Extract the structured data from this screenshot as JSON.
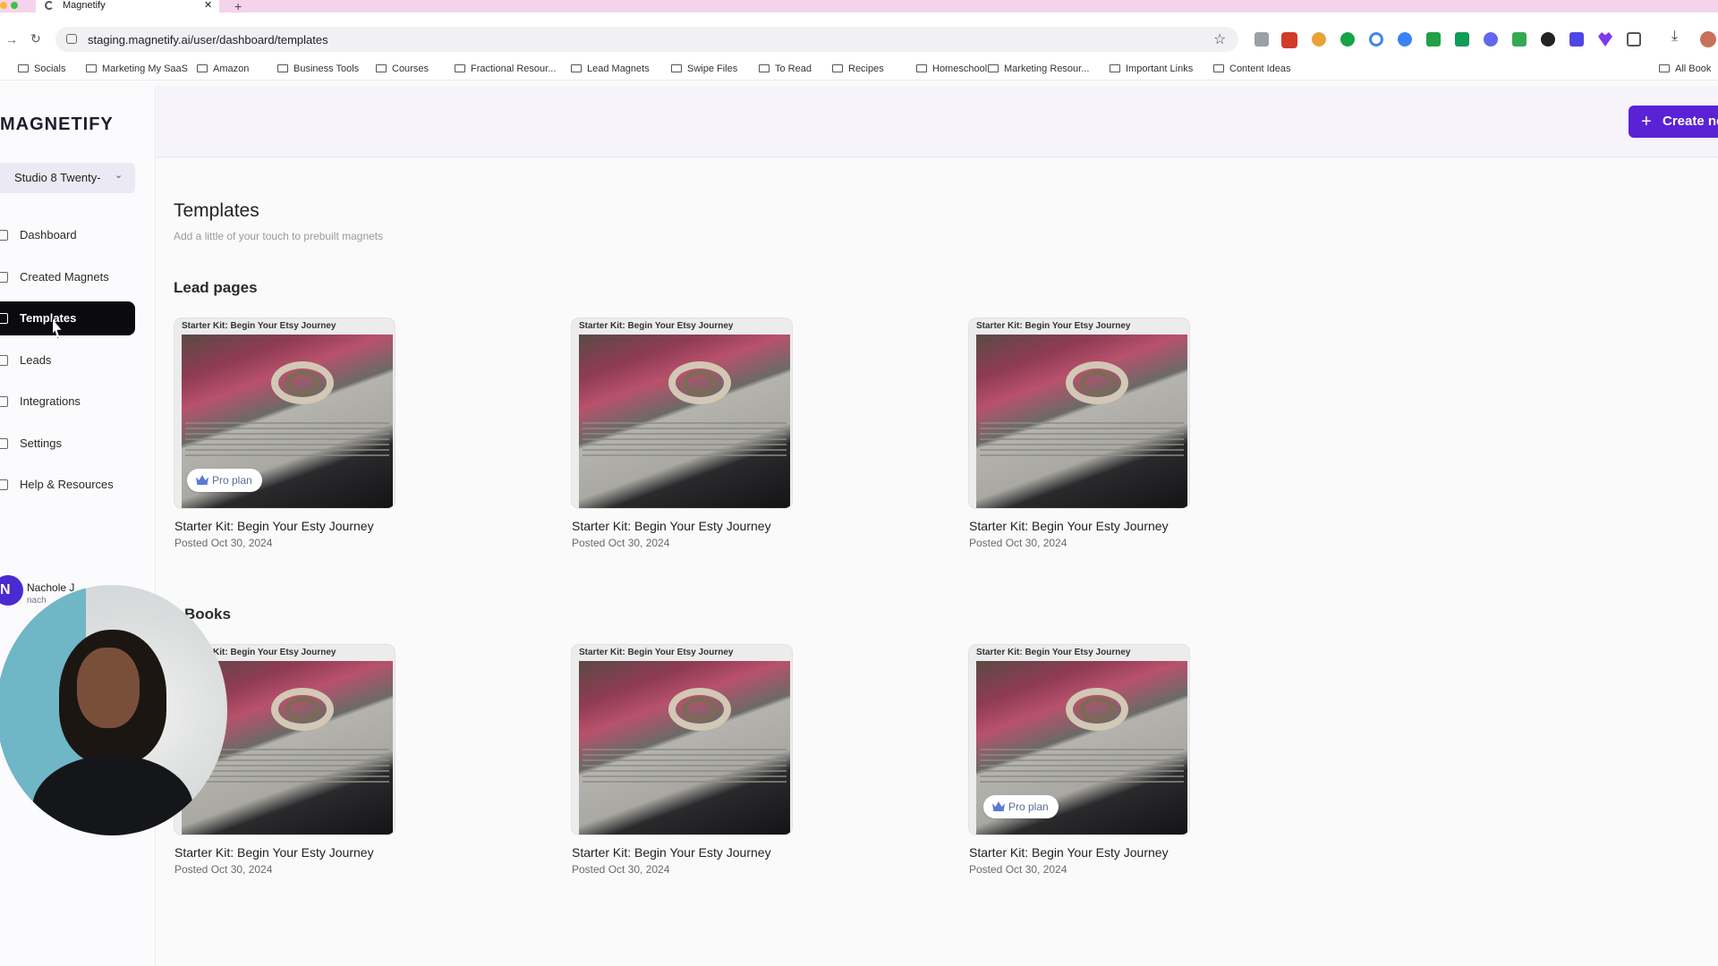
{
  "browser": {
    "tab_title": "Magnetify",
    "new_tab": "+",
    "close_tab": "✕",
    "url": "staging.magnetify.ai/user/dashboard/templates",
    "bookmarks": [
      "Socials",
      "Marketing My SaaS",
      "Amazon",
      "Business Tools",
      "Courses",
      "Fractional Resour...",
      "Lead Magnets",
      "Swipe Files",
      "To Read",
      "Recipes",
      "Homeschool",
      "Marketing Resour...",
      "Important Links",
      "Content Ideas"
    ],
    "all_bookmarks": "All Book"
  },
  "sidebar": {
    "logo": "MAGNETIFY",
    "workspace": "Studio 8 Twenty-",
    "items": [
      {
        "label": "Dashboard",
        "icon": "grid-icon"
      },
      {
        "label": "Created Magnets",
        "icon": "magnet-icon"
      },
      {
        "label": "Templates",
        "icon": "file-icon"
      },
      {
        "label": "Leads",
        "icon": "contacts-icon"
      },
      {
        "label": "Integrations",
        "icon": "plug-icon"
      },
      {
        "label": "Settings",
        "icon": "gear-icon"
      },
      {
        "label": "Help & Resources",
        "icon": "help-icon"
      }
    ],
    "active": "Templates",
    "user": {
      "initial": "N",
      "name": "Nachole J",
      "email": "nach"
    }
  },
  "header": {
    "create_label": "Create ne"
  },
  "page": {
    "title": "Templates",
    "subtitle": "Add a little of your touch to prebuilt magnets"
  },
  "sections": [
    {
      "title": "Lead pages",
      "cards": [
        {
          "thumb_title": "Starter Kit: Begin Your Etsy Journey",
          "title": "Starter Kit: Begin Your Esty Journey",
          "date": "Posted Oct 30, 2024",
          "badge": "Pro plan"
        },
        {
          "thumb_title": "Starter Kit: Begin Your Etsy Journey",
          "title": "Starter Kit: Begin Your Esty Journey",
          "date": "Posted Oct 30, 2024",
          "badge": ""
        },
        {
          "thumb_title": "Starter Kit: Begin Your Etsy Journey",
          "title": "Starter Kit: Begin Your Esty Journey",
          "date": "Posted Oct 30, 2024",
          "badge": ""
        }
      ]
    },
    {
      "title": "Books",
      "cards": [
        {
          "thumb_title": "Starter Kit: Begin Your Etsy Journey",
          "title": "Starter Kit: Begin Your Esty Journey",
          "date": "Posted Oct 30, 2024",
          "badge": ""
        },
        {
          "thumb_title": "Starter Kit: Begin Your Etsy Journey",
          "title": "Starter Kit: Begin Your Esty Journey",
          "date": "Posted Oct 30, 2024",
          "badge": ""
        },
        {
          "thumb_title": "Starter Kit: Begin Your Etsy Journey",
          "title": "Starter Kit: Begin Your Esty Journey",
          "date": "Posted Oct 30, 2024",
          "badge": "Pro plan"
        }
      ]
    }
  ],
  "colors": {
    "accent": "#5b21d6",
    "active_nav": "#0b0b0f",
    "tabbar": "#f6d3ec"
  }
}
